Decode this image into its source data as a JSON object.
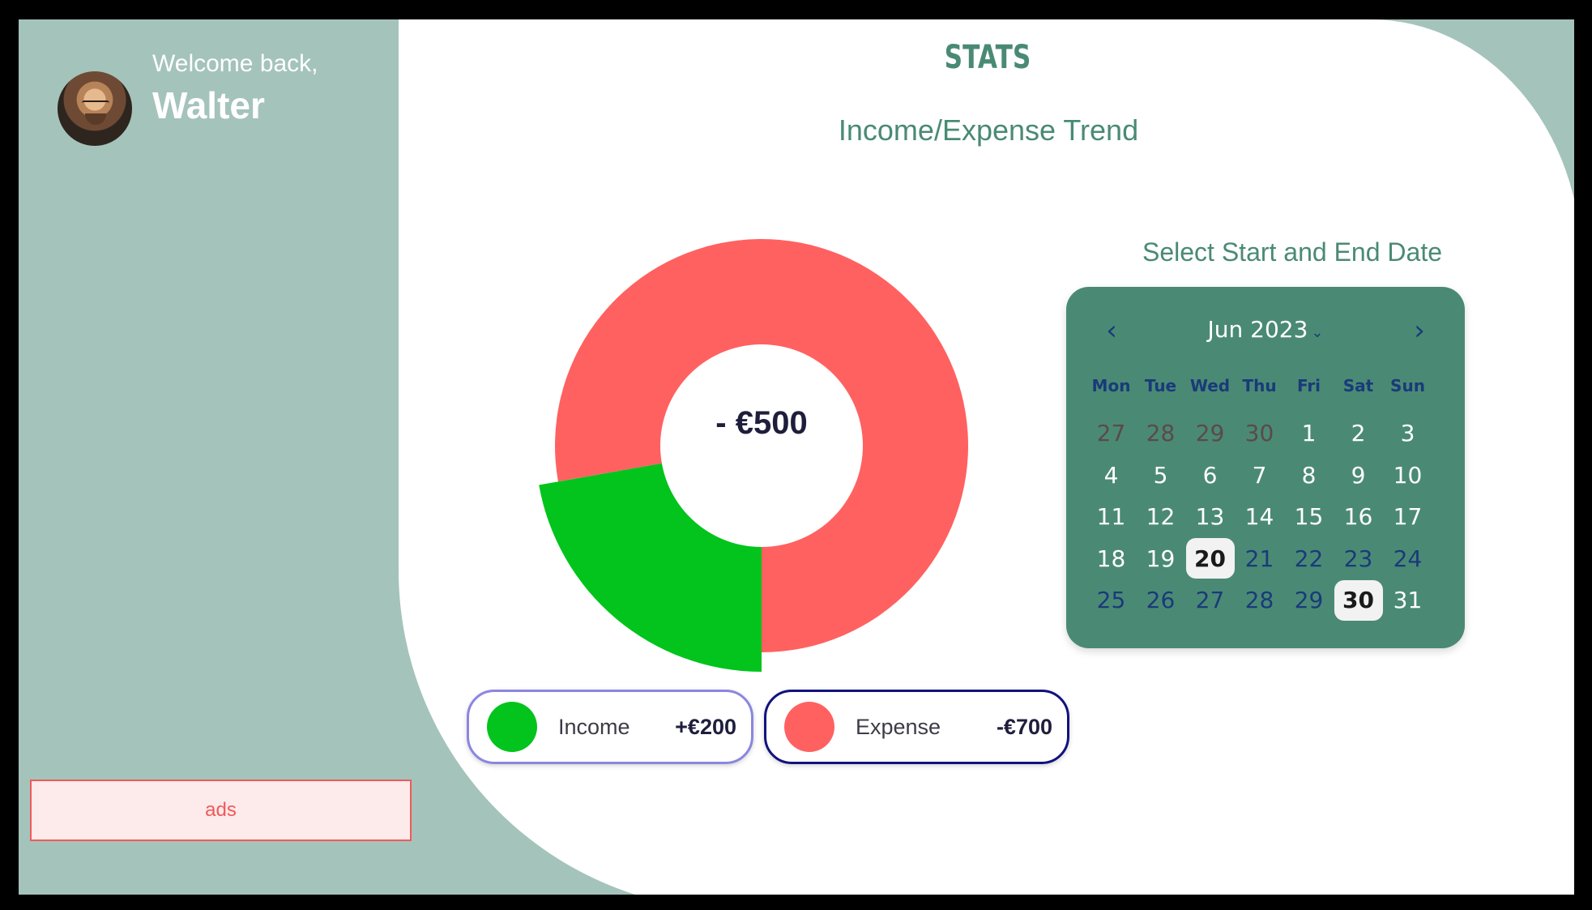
{
  "sidebar": {
    "welcome_text": "Welcome back,",
    "user_name": "Walter",
    "ads_label": "ads"
  },
  "main": {
    "title": "STATS",
    "subtitle": "Income/Expense Trend",
    "center_value": "- €500"
  },
  "chart_data": {
    "type": "pie",
    "categories": [
      "Income",
      "Expense"
    ],
    "values": [
      200,
      700
    ],
    "colors": [
      "#02c41c",
      "#ff6161"
    ],
    "title": "Income/Expense Trend",
    "center_label": "- €500"
  },
  "legend": {
    "income": {
      "label": "Income",
      "amount": "+€200",
      "color": "#02c41c"
    },
    "expense": {
      "label": "Expense",
      "amount": "-€700",
      "color": "#ff6161"
    }
  },
  "calendar": {
    "title": "Select Start and End Date",
    "month_label": "Jun 2023",
    "weekdays": [
      "Mon",
      "Tue",
      "Wed",
      "Thu",
      "Fri",
      "Sat",
      "Sun"
    ],
    "days": [
      {
        "d": "27",
        "t": "prev"
      },
      {
        "d": "28",
        "t": "prev"
      },
      {
        "d": "29",
        "t": "prev"
      },
      {
        "d": "30",
        "t": "prev"
      },
      {
        "d": "1",
        "t": "cur"
      },
      {
        "d": "2",
        "t": "cur"
      },
      {
        "d": "3",
        "t": "cur"
      },
      {
        "d": "4",
        "t": "cur"
      },
      {
        "d": "5",
        "t": "cur"
      },
      {
        "d": "6",
        "t": "cur"
      },
      {
        "d": "7",
        "t": "cur"
      },
      {
        "d": "8",
        "t": "cur"
      },
      {
        "d": "9",
        "t": "cur"
      },
      {
        "d": "10",
        "t": "cur"
      },
      {
        "d": "11",
        "t": "cur"
      },
      {
        "d": "12",
        "t": "cur"
      },
      {
        "d": "13",
        "t": "cur"
      },
      {
        "d": "14",
        "t": "cur"
      },
      {
        "d": "15",
        "t": "cur"
      },
      {
        "d": "16",
        "t": "cur"
      },
      {
        "d": "17",
        "t": "cur"
      },
      {
        "d": "18",
        "t": "cur"
      },
      {
        "d": "19",
        "t": "cur"
      },
      {
        "d": "20",
        "t": "sel"
      },
      {
        "d": "21",
        "t": "range"
      },
      {
        "d": "22",
        "t": "range"
      },
      {
        "d": "23",
        "t": "range"
      },
      {
        "d": "24",
        "t": "range"
      },
      {
        "d": "25",
        "t": "range"
      },
      {
        "d": "26",
        "t": "range"
      },
      {
        "d": "27",
        "t": "range"
      },
      {
        "d": "28",
        "t": "range"
      },
      {
        "d": "29",
        "t": "range"
      },
      {
        "d": "30",
        "t": "sel"
      },
      {
        "d": "31",
        "t": "cur"
      }
    ],
    "start_date": "20",
    "end_date": "30"
  },
  "colors": {
    "accent": "#4a8a74",
    "sidebar_bg": "#a4c3bb",
    "income": "#02c41c",
    "expense": "#ff6161"
  }
}
